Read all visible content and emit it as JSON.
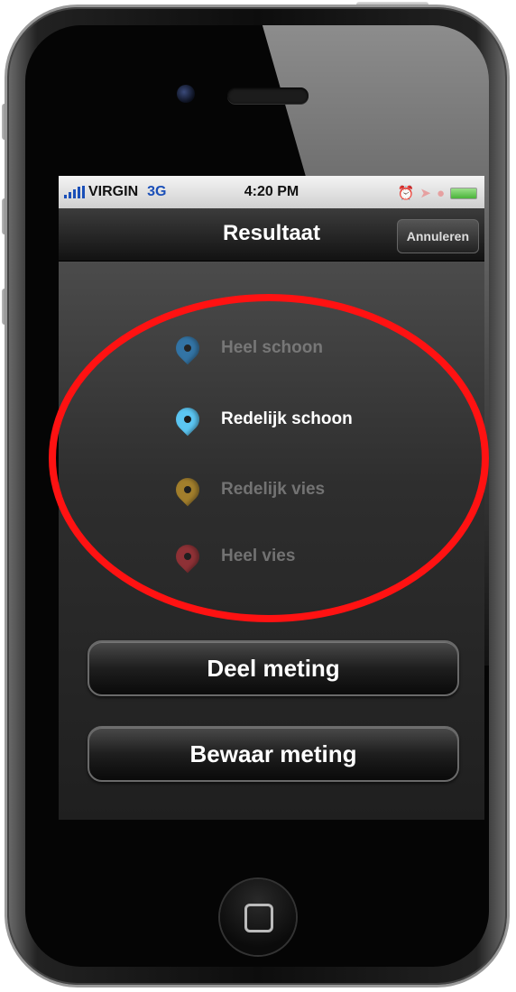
{
  "status_bar": {
    "carrier": "VIRGIN",
    "network": "3G",
    "time": "4:20 PM",
    "icons": [
      "signal-bars-icon",
      "alarm-icon",
      "location-arrow-icon",
      "lock-rotation-icon",
      "battery-icon"
    ]
  },
  "nav_bar": {
    "title": "Resultaat",
    "cancel_label": "Annuleren"
  },
  "result_options": [
    {
      "label": "Heel schoon",
      "pin_color": "#2f86c7",
      "selected": false
    },
    {
      "label": "Redelijk schoon",
      "pin_color": "#5cc6f2",
      "selected": true
    },
    {
      "label": "Redelijk vies",
      "pin_color": "#c99a2c",
      "selected": false
    },
    {
      "label": "Heel vies",
      "pin_color": "#b0343a",
      "selected": false
    }
  ],
  "actions": {
    "share_label": "Deel meting",
    "save_label": "Bewaar meting"
  },
  "annotation": {
    "color": "#ff1212",
    "shape": "ellipse"
  }
}
